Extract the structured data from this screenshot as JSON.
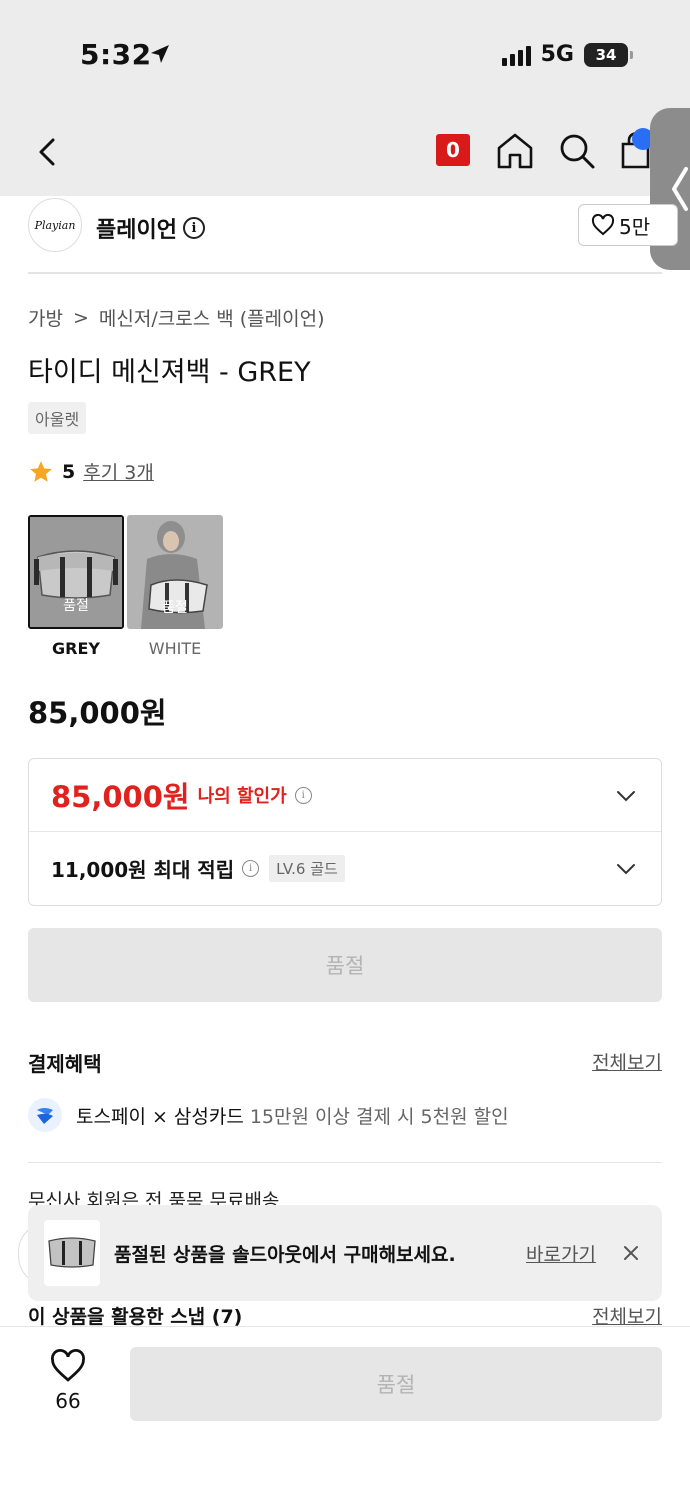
{
  "status_bar": {
    "time": "5:32",
    "network": "5G",
    "battery": "34"
  },
  "nav": {
    "cart_badge": "0"
  },
  "brand": {
    "name": "플레이언",
    "logo_text": "Playian",
    "likes": "5만"
  },
  "breadcrumb": {
    "level1": "가방",
    "separator": ">",
    "level2": "메신저/크로스 백 (플레이언)"
  },
  "product": {
    "title": "타이디 메신져백 - GREY",
    "tag": "아울렛",
    "rating": "5",
    "review_link": "후기 3개",
    "colors": [
      {
        "name": "GREY",
        "status": "품절",
        "selected": true
      },
      {
        "name": "WHITE",
        "status": "품절",
        "selected": false
      }
    ],
    "price": "85,000원"
  },
  "price_box": {
    "my_price": "85,000원",
    "my_price_label": "나의 할인가",
    "points": "11,000원 최대 적립",
    "level_badge": "LV.6 골드"
  },
  "soldout_button": "품절",
  "benefits": {
    "title": "결제혜택",
    "see_all": "전체보기",
    "toss_main": "토스페이 × 삼성카드",
    "toss_desc": "15만원 이상 결제 시 5천원 할인"
  },
  "shipping_text": "무신사 회원은 전 품목 무료배송",
  "toast": {
    "message": "품절된 상품을 솔드아웃에서 구매해보세요.",
    "link": "바로가기"
  },
  "snap": {
    "title": "이 상품을 활용한 스냅 (7)",
    "see_all": "전체보기"
  },
  "bottom": {
    "like_count": "66",
    "button": "품절"
  },
  "colors": {
    "accent_red": "#e0211e",
    "badge_red": "#d91a1a",
    "disabled_bg": "#e6e6e6"
  }
}
